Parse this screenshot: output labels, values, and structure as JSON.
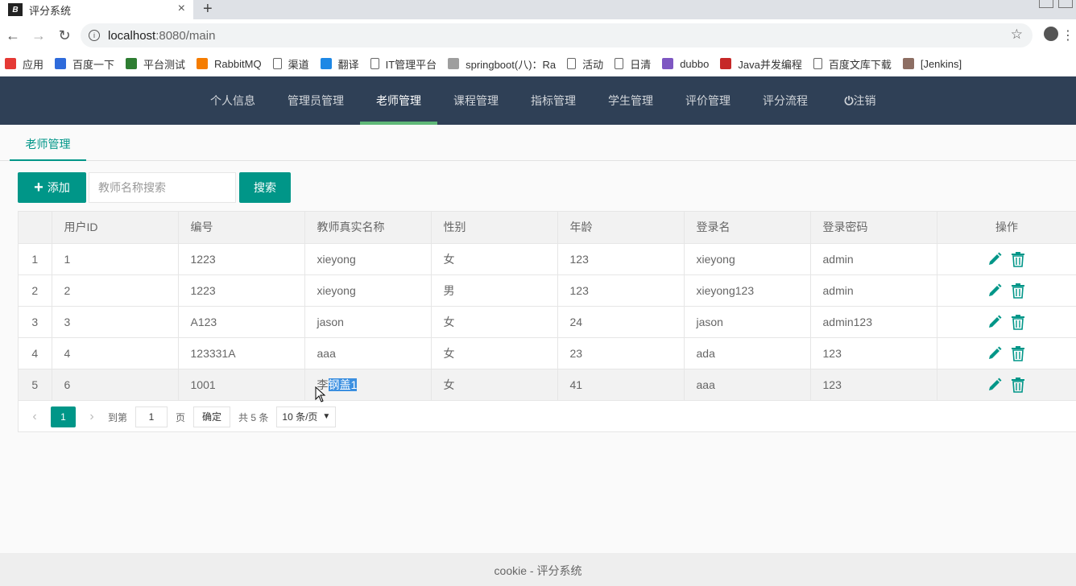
{
  "browser": {
    "tab_title": "评分系统",
    "favicon_text": "B",
    "url_host": "localhost",
    "url_path": ":8080/main",
    "bookmarks": [
      {
        "label": "应用",
        "color": "#e53935"
      },
      {
        "label": "百度一下",
        "color": "#2f6bdb"
      },
      {
        "label": "平台测试",
        "color": "#2e7d32"
      },
      {
        "label": "RabbitMQ",
        "color": "#f57c00"
      },
      {
        "label": "渠道",
        "color": "#ffffff"
      },
      {
        "label": "翻译",
        "color": "#1e88e5"
      },
      {
        "label": "IT管理平台",
        "color": "#ffffff"
      },
      {
        "label": "springboot(八)：Ra",
        "color": "#9e9e9e"
      },
      {
        "label": "活动",
        "color": "#ffffff"
      },
      {
        "label": "日清",
        "color": "#ffffff"
      },
      {
        "label": "dubbo",
        "color": "#7e57c2"
      },
      {
        "label": "Java并发编程",
        "color": "#c62828"
      },
      {
        "label": "百度文库下载",
        "color": "#ffffff"
      },
      {
        "label": "[Jenkins]",
        "color": "#8d6e63"
      }
    ]
  },
  "nav": {
    "items": [
      "个人信息",
      "管理员管理",
      "老师管理",
      "课程管理",
      "指标管理",
      "学生管理",
      "评价管理",
      "评分流程",
      "注销"
    ],
    "active_index": 2
  },
  "subtab": "老师管理",
  "toolbar": {
    "add_label": "添加",
    "search_placeholder": "教师名称搜索",
    "search_label": "搜索"
  },
  "table": {
    "headers": [
      "",
      "用户ID",
      "编号",
      "教师真实名称",
      "性别",
      "年龄",
      "登录名",
      "登录密码",
      "操作"
    ],
    "rows": [
      [
        "1",
        "1",
        "1223",
        "xieyong",
        "女",
        "123",
        "xieyong",
        "admin"
      ],
      [
        "2",
        "2",
        "1223",
        "xieyong",
        "男",
        "123",
        "xieyong123",
        "admin"
      ],
      [
        "3",
        "3",
        "A123",
        "jason",
        "女",
        "24",
        "jason",
        "admin123"
      ],
      [
        "4",
        "4",
        "123331A",
        "aaa",
        "女",
        "23",
        "ada",
        "123"
      ],
      [
        "5",
        "6",
        "1001",
        "李钢盖1",
        "女",
        "41",
        "aaa",
        "123"
      ]
    ],
    "selected_name_prefix": "李",
    "selected_name_highlight": "钢盖1"
  },
  "pager": {
    "current": "1",
    "goto_label": "到第",
    "goto_value": "1",
    "page_label": "页",
    "confirm_label": "确定",
    "total_label": "共 5 条",
    "per_page": "10 条/页"
  },
  "footer": "cookie - 评分系统",
  "colors": {
    "header_bg": "#2f4056",
    "accent": "#009688",
    "nav_active_bar": "#5fb878"
  }
}
